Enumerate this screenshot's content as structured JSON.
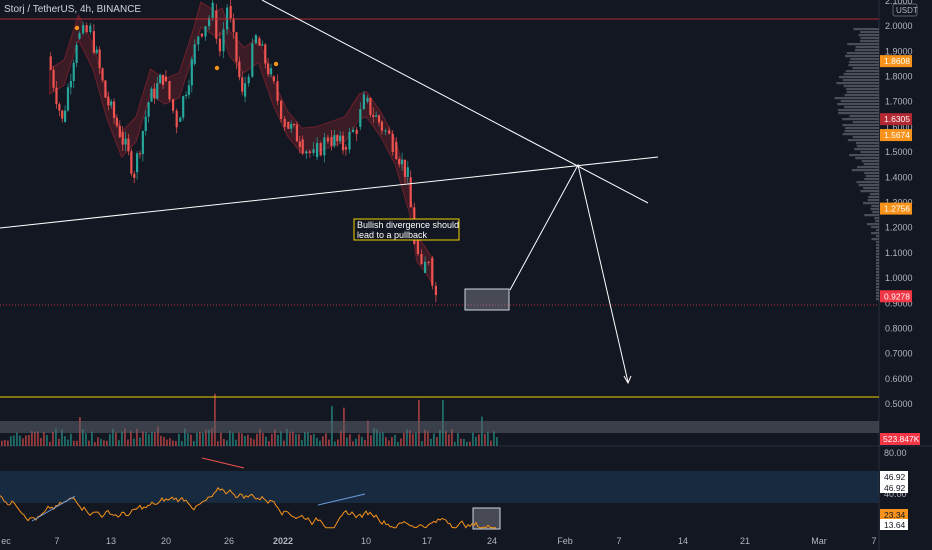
{
  "header": {
    "symbol_title": "Storj / TetherUS, 4h, BINANCE"
  },
  "price_axis": {
    "currency": "USDT",
    "ticks": [
      "2.1000",
      "2.0000",
      "1.9000",
      "1.8000",
      "1.7000",
      "1.6000",
      "1.5000",
      "1.4000",
      "1.3000",
      "1.2000",
      "1.1000",
      "1.0000",
      "0.9000",
      "0.8000",
      "0.7000",
      "0.6000",
      "0.5000"
    ],
    "tags": [
      {
        "label": "1.8608",
        "color": "#f7931a"
      },
      {
        "label": "1.6305",
        "color": "#b22833"
      },
      {
        "label": "1.5674",
        "color": "#f7931a"
      },
      {
        "label": "1.2756",
        "color": "#f7931a"
      },
      {
        "label": "0.9278",
        "color": "#f23645"
      }
    ]
  },
  "volume": {
    "tag": "523.847K"
  },
  "rsi": {
    "ticks": [
      "80.00",
      "40.00"
    ],
    "tags": [
      {
        "label": "46.92",
        "color": "#ffffff"
      },
      {
        "label": "46.92",
        "color": "#ffffff"
      },
      {
        "label": "23.34",
        "color": "#f7931a"
      },
      {
        "label": "13.64",
        "color": "#ffffff"
      }
    ]
  },
  "time_axis": {
    "labels": [
      "ec",
      "7",
      "13",
      "20",
      "26",
      "2022",
      "10",
      "17",
      "24",
      "Feb",
      "7",
      "14",
      "21",
      "Mar",
      "7"
    ]
  },
  "annotation": {
    "line1": "Bullish divergence should",
    "line2": "lead to a pullback"
  },
  "colors": {
    "up": "#26a69a",
    "down": "#ef5350",
    "bg": "#131722",
    "rsi": "#f7931a",
    "trendline": "#ffffff",
    "support": "#f0d000",
    "resistance": "#b22833"
  },
  "chart_data": {
    "type": "candlestick",
    "title": "Storj / TetherUS, 4h, BINANCE",
    "ylim": [
      0.45,
      2.12
    ],
    "price_path": [
      [
        "2021-12-01",
        1.88
      ],
      [
        "2021-12-03",
        1.62
      ],
      [
        "2021-12-05",
        1.95
      ],
      [
        "2021-12-07",
        1.98
      ],
      [
        "2021-12-09",
        1.72
      ],
      [
        "2021-12-11",
        1.58
      ],
      [
        "2021-12-13",
        1.42
      ],
      [
        "2021-12-15",
        1.7
      ],
      [
        "2021-12-17",
        1.8
      ],
      [
        "2021-12-19",
        1.62
      ],
      [
        "2021-12-21",
        1.85
      ],
      [
        "2021-12-22",
        1.97
      ],
      [
        "2021-12-24",
        2.06
      ],
      [
        "2021-12-25",
        1.9
      ],
      [
        "2021-12-26",
        2.08
      ],
      [
        "2021-12-28",
        1.72
      ],
      [
        "2021-12-30",
        1.95
      ],
      [
        "2022-01-01",
        1.8
      ],
      [
        "2022-01-03",
        1.62
      ],
      [
        "2022-01-05",
        1.55
      ],
      [
        "2022-01-07",
        1.48
      ],
      [
        "2022-01-09",
        1.56
      ],
      [
        "2022-01-11",
        1.52
      ],
      [
        "2022-01-13",
        1.6
      ],
      [
        "2022-01-14",
        1.7
      ],
      [
        "2022-01-16",
        1.62
      ],
      [
        "2022-01-18",
        1.54
      ],
      [
        "2022-01-20",
        1.4
      ],
      [
        "2022-01-21",
        1.15
      ],
      [
        "2022-01-22",
        1.02
      ],
      [
        "2022-01-23",
        1.08
      ],
      [
        "2022-01-24",
        0.93
      ]
    ],
    "horizontal_levels": [
      {
        "name": "resistance",
        "value": 2.03
      },
      {
        "name": "support",
        "value": 0.58
      },
      {
        "name": "last_price",
        "value": 0.9278
      }
    ],
    "projection_path": [
      [
        "2022-01-24",
        1.01
      ],
      [
        "2022-01-31",
        1.46
      ],
      [
        "2022-02-06",
        0.69
      ]
    ],
    "rsi_range": [
      0,
      100
    ]
  }
}
